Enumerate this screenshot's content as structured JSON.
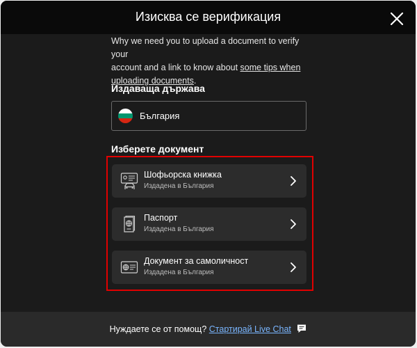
{
  "header": {
    "title": "Изисква се верификация"
  },
  "intro": {
    "line1": "Why we need you to upload a document to verify your",
    "line2_prefix": "account and a link to know about ",
    "link_text_1": "some tips when",
    "link_text_2": "uploading documents",
    "suffix": "."
  },
  "country": {
    "label": "Издаваща държава",
    "value": "България",
    "flag_colors": [
      "#ffffff",
      "#00966e",
      "#d62612"
    ]
  },
  "documents": {
    "label": "Изберете документ",
    "items": [
      {
        "title": "Шофьорска книжка",
        "subtitle": "Издадена в България",
        "icon": "driver-license-icon"
      },
      {
        "title": "Паспорт",
        "subtitle": "Издадена в България",
        "icon": "passport-icon"
      },
      {
        "title": "Документ за самоличност",
        "subtitle": "Издадена в България",
        "icon": "id-card-icon"
      }
    ]
  },
  "footer": {
    "help_text": "Нуждаете се от помощ?",
    "live_chat_link": "Стартирай Live Chat"
  },
  "colors": {
    "highlight_border": "#e10000",
    "link": "#7ab6ff",
    "card_bg": "#2c2c2c"
  }
}
